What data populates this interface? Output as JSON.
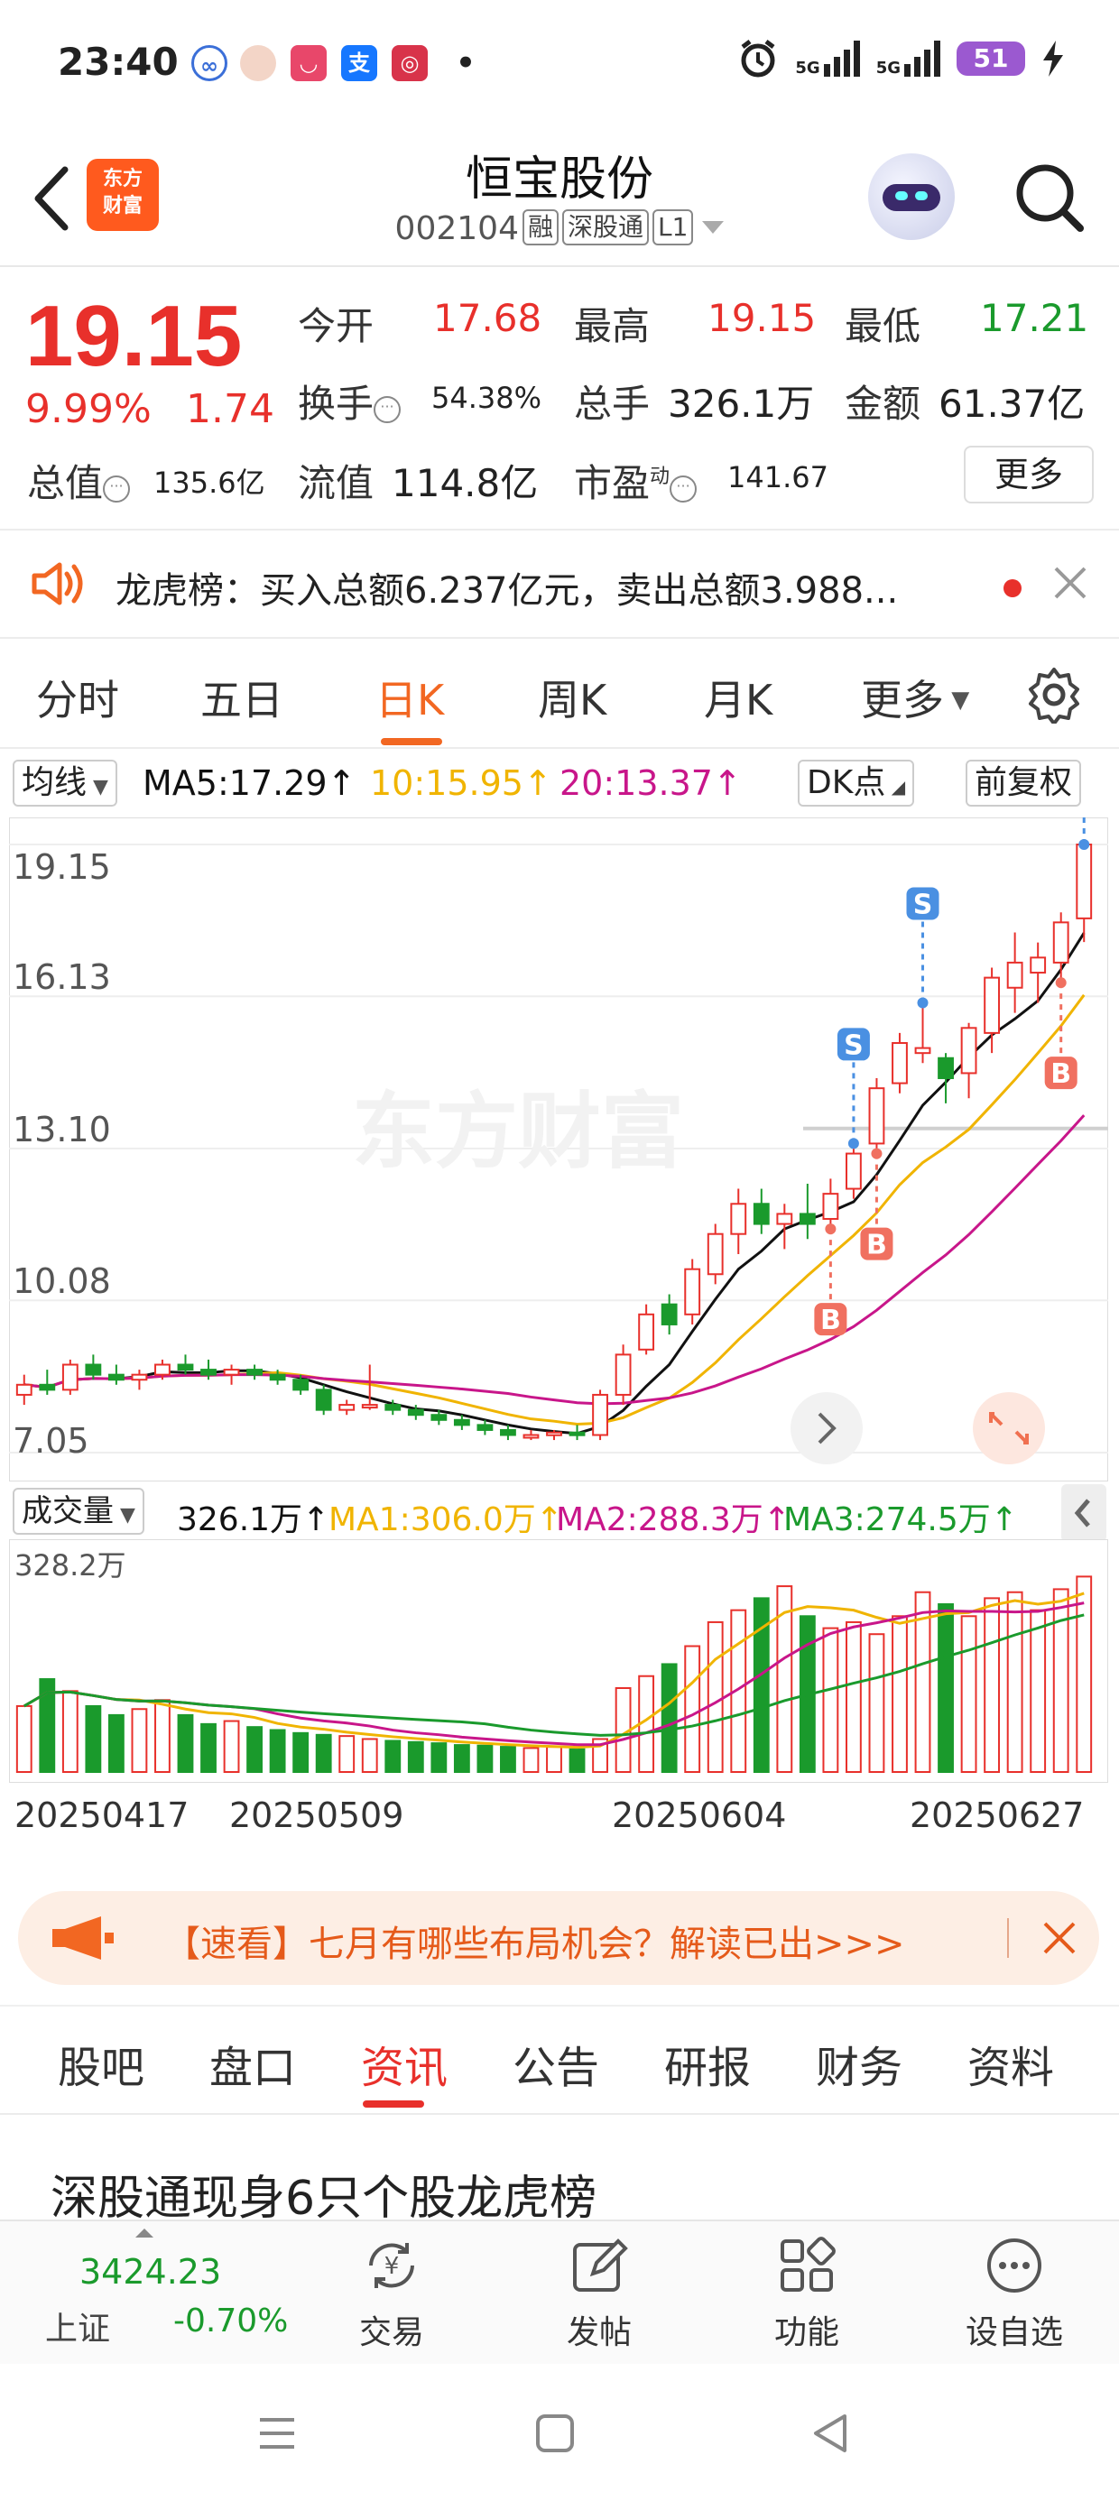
{
  "status_bar": {
    "time": "23:40",
    "battery": "51",
    "net1": "5G",
    "net2": "5G"
  },
  "header": {
    "stock_name": "恒宝股份",
    "stock_code": "002104",
    "tags": [
      "融",
      "深股通",
      "L1"
    ],
    "logo_line1": "东方",
    "logo_line2": "财富"
  },
  "quote": {
    "price": "19.15",
    "change_pct": "9.99%",
    "change_abs": "1.74",
    "open_label": "今开",
    "open_value": "17.68",
    "high_label": "最高",
    "high_value": "19.15",
    "low_label": "最低",
    "low_value": "17.21",
    "turnover_label": "换手",
    "turnover_value": "54.38%",
    "volume_label": "总手",
    "volume_value": "326.1万",
    "amount_label": "金额",
    "amount_value": "61.37亿",
    "mktcap_label": "总值",
    "mktcap_value": "135.6亿",
    "float_label": "流值",
    "float_value": "114.8亿",
    "pe_label": "市盈",
    "pe_sup": "动",
    "pe_value": "141.67",
    "more_label": "更多"
  },
  "ticker": {
    "text": "龙虎榜：买入总额6.237亿元，卖出总额3.988..."
  },
  "chart_tabs": {
    "items": [
      "分时",
      "五日",
      "日K",
      "周K",
      "月K",
      "更多"
    ],
    "active": "日K"
  },
  "ma_row": {
    "selector": "均线",
    "ma5": "MA5:17.29↑",
    "ma10": "10:15.95↑",
    "ma20": "20:13.37↑",
    "dk_label": "DK点",
    "adjust_label": "前复权"
  },
  "colors": {
    "up": "#e8302b",
    "down": "#1a9a2c",
    "accent": "#f26722",
    "ma5": "#111111",
    "ma10": "#f0b400",
    "ma20": "#c8168a",
    "signal": "#4a90e2",
    "buy": "#f07060"
  },
  "kline": {
    "y_ticks": [
      "19.15",
      "16.13",
      "13.10",
      "10.08",
      "7.05"
    ],
    "watermark": "东方财富",
    "signals": {
      "sell": "S",
      "buy": "B"
    }
  },
  "volume": {
    "selector": "成交量",
    "vol": "326.1万↑",
    "ma1": "MA1:306.0万↑",
    "ma2": "MA2:288.3万↑",
    "ma3": "MA3:274.5万↑",
    "max_label": "328.2万"
  },
  "dates": [
    "20250417",
    "20250509",
    "20250604",
    "20250627"
  ],
  "chart_data": {
    "type": "candlestick",
    "ylim": [
      7.05,
      19.15
    ],
    "candles": [
      [
        8.2,
        8.6,
        8.0,
        8.4
      ],
      [
        8.4,
        8.7,
        8.2,
        8.3
      ],
      [
        8.3,
        8.9,
        8.2,
        8.8
      ],
      [
        8.8,
        9.0,
        8.5,
        8.6
      ],
      [
        8.6,
        8.8,
        8.4,
        8.5
      ],
      [
        8.5,
        8.7,
        8.3,
        8.6
      ],
      [
        8.6,
        8.9,
        8.5,
        8.8
      ],
      [
        8.8,
        9.0,
        8.6,
        8.7
      ],
      [
        8.7,
        8.9,
        8.5,
        8.6
      ],
      [
        8.6,
        8.8,
        8.4,
        8.7
      ],
      [
        8.7,
        8.8,
        8.5,
        8.6
      ],
      [
        8.6,
        8.7,
        8.4,
        8.5
      ],
      [
        8.5,
        8.6,
        8.2,
        8.3
      ],
      [
        8.3,
        8.4,
        7.8,
        7.9
      ],
      [
        7.9,
        8.1,
        7.8,
        8.0
      ],
      [
        8.0,
        8.8,
        7.9,
        8.0
      ],
      [
        8.0,
        8.1,
        7.8,
        7.9
      ],
      [
        7.9,
        8.0,
        7.7,
        7.8
      ],
      [
        7.8,
        7.9,
        7.6,
        7.7
      ],
      [
        7.7,
        7.8,
        7.5,
        7.6
      ],
      [
        7.6,
        7.7,
        7.4,
        7.5
      ],
      [
        7.5,
        7.6,
        7.3,
        7.4
      ],
      [
        7.4,
        7.5,
        7.3,
        7.4
      ],
      [
        7.4,
        7.5,
        7.3,
        7.45
      ],
      [
        7.45,
        7.6,
        7.3,
        7.4
      ],
      [
        7.4,
        8.3,
        7.3,
        8.2
      ],
      [
        8.2,
        9.2,
        8.0,
        9.0
      ],
      [
        9.1,
        10.0,
        9.0,
        9.8
      ],
      [
        10.0,
        10.2,
        9.4,
        9.6
      ],
      [
        9.8,
        10.9,
        9.6,
        10.7
      ],
      [
        10.6,
        11.6,
        10.4,
        11.4
      ],
      [
        11.4,
        12.3,
        11.0,
        12.0
      ],
      [
        12.0,
        12.3,
        11.4,
        11.6
      ],
      [
        11.6,
        12.0,
        11.1,
        11.8
      ],
      [
        11.8,
        12.4,
        11.3,
        11.6
      ],
      [
        11.7,
        12.5,
        11.5,
        12.2
      ],
      [
        12.3,
        13.2,
        12.1,
        13.0
      ],
      [
        13.2,
        14.5,
        13.0,
        14.3
      ],
      [
        14.4,
        15.4,
        14.2,
        15.2
      ],
      [
        15.0,
        16.0,
        14.8,
        15.1
      ],
      [
        14.9,
        15.0,
        14.0,
        14.5
      ],
      [
        14.6,
        15.6,
        14.1,
        15.5
      ],
      [
        15.4,
        16.7,
        15.0,
        16.5
      ],
      [
        16.3,
        17.4,
        15.8,
        16.8
      ],
      [
        16.6,
        17.2,
        16.0,
        16.9
      ],
      [
        16.8,
        17.8,
        16.4,
        17.6
      ],
      [
        17.68,
        19.15,
        17.21,
        19.15
      ]
    ],
    "volumes": [
      110,
      155,
      135,
      110,
      95,
      105,
      120,
      95,
      80,
      85,
      75,
      70,
      65,
      62,
      60,
      55,
      52,
      50,
      48,
      45,
      44,
      42,
      40,
      42,
      38,
      55,
      140,
      160,
      180,
      210,
      250,
      270,
      290,
      310,
      260,
      240,
      250,
      230,
      260,
      300,
      280,
      260,
      290,
      300,
      270,
      305,
      326.1
    ],
    "vol_max": 328.2
  },
  "promo": {
    "text": "【速看】七月有哪些布局机会？解读已出>>>"
  },
  "news_tabs": {
    "items": [
      "股吧",
      "盘口",
      "资讯",
      "公告",
      "研报",
      "财务",
      "资料"
    ],
    "active": "资讯"
  },
  "news": {
    "headline": "深股通现身6只个股龙虎榜"
  },
  "bottom_bar": {
    "index_value": "3424.23",
    "index_name": "上证",
    "index_change": "-0.70%",
    "items": [
      "交易",
      "发帖",
      "功能",
      "设自选"
    ]
  }
}
